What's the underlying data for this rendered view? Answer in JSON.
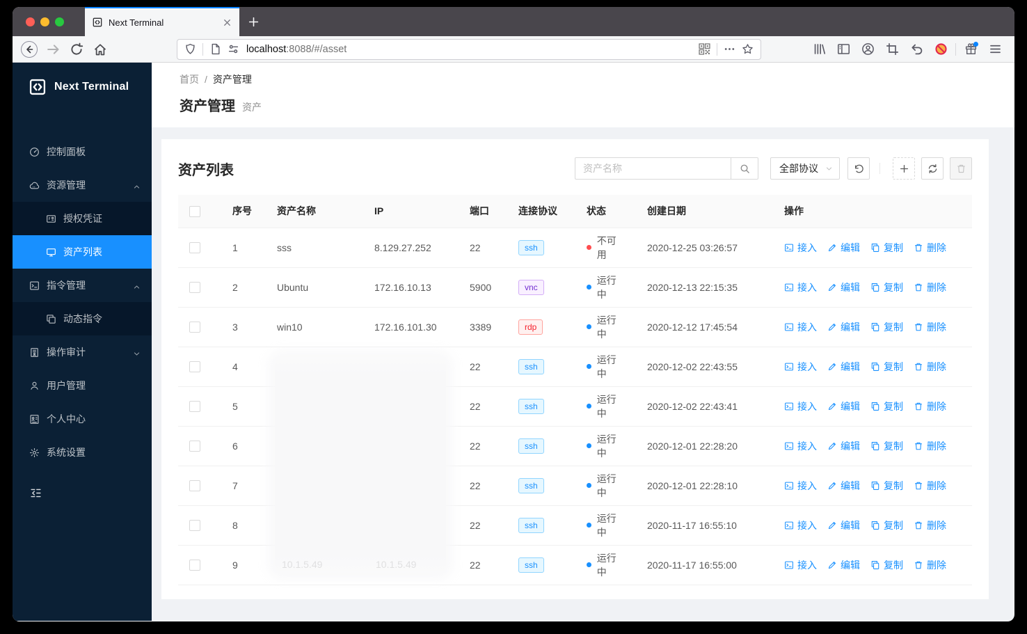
{
  "browser": {
    "tab_title": "Next Terminal",
    "url_host": "localhost",
    "url_path": ":8088/#/asset",
    "nav_icons": [
      "back-icon",
      "forward-icon",
      "reload-icon",
      "home-icon"
    ],
    "urlbar_left_icons": [
      "shield-icon",
      "divider",
      "page-icon",
      "permissions-icon"
    ],
    "urlbar_right_icons": [
      "qr-code-icon",
      "divider",
      "page-actions-icon",
      "bookmark-star-icon"
    ],
    "toolbar_right_icons": [
      "library-icon",
      "sidebar-panel-icon",
      "account-icon",
      "screenshot-icon",
      "undo-nav-icon",
      "blocked-extension-icon",
      "divider",
      "whatsnew-gift-icon",
      "app-menu-icon"
    ]
  },
  "sidebar": {
    "logo_text": "Next Terminal",
    "items": [
      {
        "label": "控制面板",
        "icon": "dashboard-icon",
        "type": "item"
      },
      {
        "label": "资源管理",
        "icon": "cloud-icon",
        "type": "item",
        "chevron": "up"
      },
      {
        "label": "授权凭证",
        "icon": "credential-icon",
        "type": "sub"
      },
      {
        "label": "资产列表",
        "icon": "desktop-icon",
        "type": "sub",
        "selected": true
      },
      {
        "label": "指令管理",
        "icon": "code-icon",
        "type": "item",
        "chevron": "up"
      },
      {
        "label": "动态指令",
        "icon": "block-icon",
        "type": "sub"
      },
      {
        "label": "操作审计",
        "icon": "audit-icon",
        "type": "item",
        "chevron": "down"
      },
      {
        "label": "用户管理",
        "icon": "user-icon",
        "type": "item"
      },
      {
        "label": "个人中心",
        "icon": "profile-icon",
        "type": "item"
      },
      {
        "label": "系统设置",
        "icon": "settings-icon",
        "type": "item"
      }
    ]
  },
  "breadcrumb": {
    "home": "首页",
    "separator": "/",
    "current": "资产管理"
  },
  "page_header": {
    "title": "资产管理",
    "subtitle": "资产"
  },
  "panel": {
    "title": "资产列表",
    "search_placeholder": "资产名称",
    "protocol_select": "全部协议"
  },
  "table": {
    "headers": [
      "序号",
      "资产名称",
      "IP",
      "端口",
      "连接协议",
      "状态",
      "创建日期",
      "操作"
    ],
    "action_labels": [
      "接入",
      "编辑",
      "复制",
      "删除"
    ],
    "action_icons": [
      "terminal-icon",
      "edit-icon",
      "copy-icon",
      "delete-icon"
    ],
    "rows": [
      {
        "no": "1",
        "name": "sss",
        "ip": "8.129.27.252",
        "port": "22",
        "protocol": "ssh",
        "status": "不可用",
        "status_type": "unavailable",
        "created": "2020-12-25 03:26:57"
      },
      {
        "no": "2",
        "name": "Ubuntu",
        "ip": "172.16.10.13",
        "port": "5900",
        "protocol": "vnc",
        "status": "运行中",
        "status_type": "running",
        "created": "2020-12-13 22:15:35"
      },
      {
        "no": "3",
        "name": "win10",
        "ip": "172.16.101.30",
        "port": "3389",
        "protocol": "rdp",
        "status": "运行中",
        "status_type": "running",
        "created": "2020-12-12 17:45:54"
      },
      {
        "no": "4",
        "name": "",
        "ip": "",
        "blurred": true,
        "port": "22",
        "protocol": "ssh",
        "status": "运行中",
        "status_type": "running",
        "created": "2020-12-02 22:43:55"
      },
      {
        "no": "5",
        "name": "",
        "ip": "",
        "blurred": true,
        "port": "22",
        "protocol": "ssh",
        "status": "运行中",
        "status_type": "running",
        "created": "2020-12-02 22:43:41"
      },
      {
        "no": "6",
        "name": "",
        "ip": "",
        "blurred": true,
        "port": "22",
        "protocol": "ssh",
        "status": "运行中",
        "status_type": "running",
        "created": "2020-12-01 22:28:20"
      },
      {
        "no": "7",
        "name": "",
        "ip": "",
        "blurred": true,
        "port": "22",
        "protocol": "ssh",
        "status": "运行中",
        "status_type": "running",
        "created": "2020-12-01 22:28:10"
      },
      {
        "no": "8",
        "name": "",
        "ip": "",
        "blurred": true,
        "port": "22",
        "protocol": "ssh",
        "status": "运行中",
        "status_type": "running",
        "created": "2020-11-17 16:55:10"
      },
      {
        "no": "9",
        "name": "",
        "ip": "",
        "blurred": true,
        "port": "22",
        "protocol": "ssh",
        "status": "运行中",
        "status_type": "running",
        "created": "2020-11-17 16:55:00"
      }
    ],
    "privacy_blur_text": "10.1.5.49"
  },
  "colors": {
    "accent": "#1890ff",
    "status_running": "#1890ff",
    "status_unavailable": "#ff4d4f",
    "tag_ssh": {
      "text": "#1890ff",
      "bg": "#e6f7ff",
      "border": "#91d5ff"
    },
    "tag_vnc": {
      "text": "#722ed1",
      "bg": "#f9f0ff",
      "border": "#d3adf7"
    },
    "tag_rdp": {
      "text": "#f5222d",
      "bg": "#fff1f0",
      "border": "#ffa39e"
    }
  }
}
